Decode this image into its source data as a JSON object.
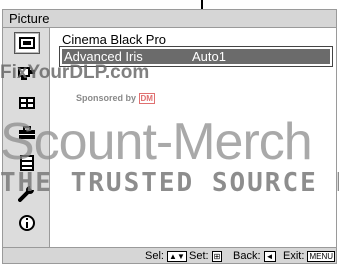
{
  "title": "Picture",
  "sidebar": {
    "items": [
      {
        "icon": "picture-icon",
        "selected": true
      },
      {
        "icon": "projection-settings-icon",
        "selected": false
      },
      {
        "icon": "screen-icon",
        "selected": false
      },
      {
        "icon": "function-icon",
        "selected": false
      },
      {
        "icon": "menu-list-icon",
        "selected": false
      },
      {
        "icon": "wrench-icon",
        "selected": false
      },
      {
        "icon": "information-icon",
        "selected": false
      }
    ]
  },
  "menu": {
    "items": [
      {
        "label": "Cinema Black Pro",
        "value": "",
        "highlighted": false
      },
      {
        "label": "Advanced Iris",
        "value": "Auto1",
        "highlighted": true
      }
    ]
  },
  "watermark": {
    "site": "FixYourDLP.com",
    "sponsored_by": "Sponsored by",
    "sponsor_logo": "DM",
    "brand": "Scount-Merch",
    "tagline": "THE TRUSTED SOURCE FO"
  },
  "statusbar": {
    "sel_label": "Sel:",
    "sel_keys": "▲▼",
    "set_label": "Set:",
    "set_key": "⊞",
    "back_label": "Back:",
    "back_key": "◄",
    "exit_label": "Exit:",
    "exit_key": "MENU"
  }
}
